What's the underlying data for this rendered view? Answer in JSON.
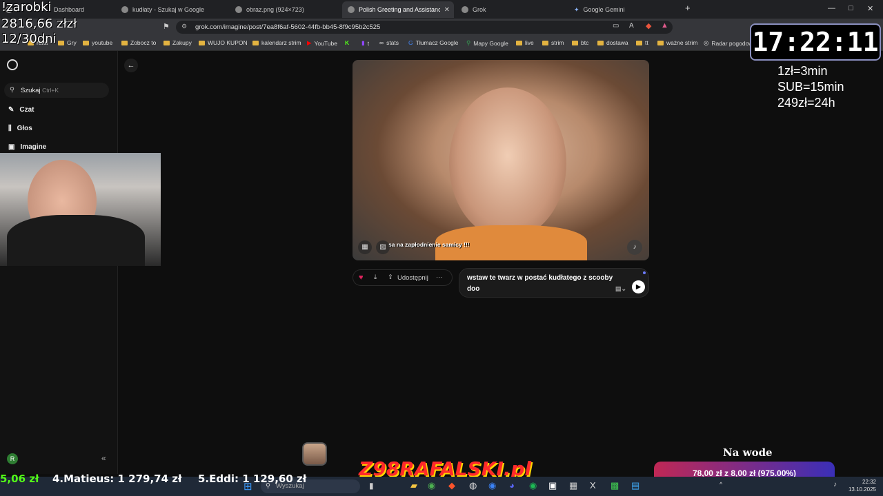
{
  "tabs": [
    {
      "label": "Dashboard"
    },
    {
      "label": "kudłaty - Szukaj w Google"
    },
    {
      "label": "obraz.png (924×723)"
    },
    {
      "label": "Polish Greeting and Assistance"
    },
    {
      "label": "Grok"
    },
    {
      "label": "Google Gemini"
    }
  ],
  "address": {
    "url": "grok.com/imagine/post/7ea8f6af-5602-44fb-bb45-8f9c95b2c525"
  },
  "bookmarks": [
    "Gry",
    "youtube",
    "Zobocz to",
    "Zakupy",
    "WUJO KUPON",
    "kalendarz strim",
    "YouTube",
    "K",
    "t",
    "stats",
    "Tłumacz Google",
    "Mapy Google",
    "live",
    "strim",
    "btc",
    "dostawa",
    "tt",
    "ważne strim",
    "Radar pogodowy"
  ],
  "sidebar": {
    "search_label": "Szukaj",
    "search_shortcut": "Ctrl+K",
    "items": [
      {
        "label": "Czat"
      },
      {
        "label": "Głos"
      },
      {
        "label": "Imagine"
      }
    ],
    "avatar_letter": "R"
  },
  "media": {
    "caption": "sa na zapłodnienie samicy !!!"
  },
  "actions": {
    "share_label": "Udostępnij",
    "more_label": "···"
  },
  "prompt": {
    "text": "wstaw te twarz w postać kudłatego z scooby doo"
  },
  "overlay": {
    "earnings_title": "!zarobki",
    "earnings_amount": "2816,66 złzł",
    "days": "12/30dni",
    "clock": "17:22:11",
    "rates": [
      "1zł=3min",
      "SUB=15min",
      "249zł=24h"
    ],
    "ticker": [
      "5,06 zł",
      "4.Matieus: 1 279,74 zł",
      "5.Eddi: 1 129,60 zł"
    ],
    "promo": "78,00 zł z 8,00 zł (975.00%)",
    "na_wode": "Na wode",
    "banner": "Z98RAFALSKI.pl"
  },
  "taskbar": {
    "search_placeholder": "Wyszukaj",
    "time": "22:32",
    "date": "13.10.2025"
  }
}
